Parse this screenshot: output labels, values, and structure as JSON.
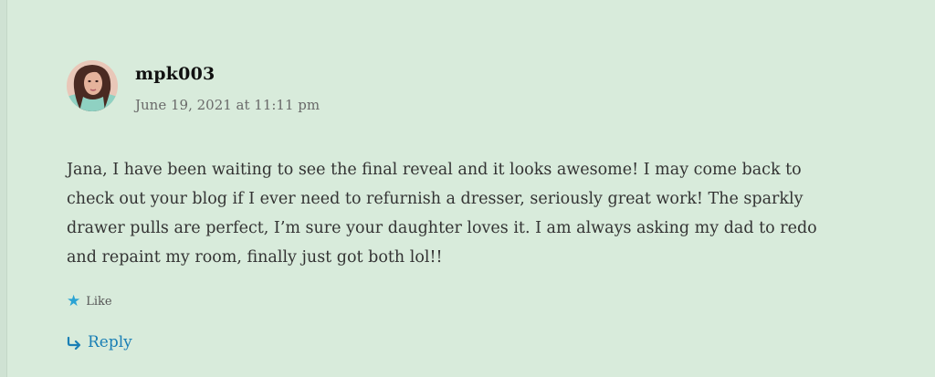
{
  "comment": {
    "author": "mpk003",
    "date": "June 19, 2021 at 11:11 pm",
    "text": "Jana, I have been waiting to see the final reveal and it looks awesome! I may come back to\ncheck out your blog if I ever need to refurnish a dresser, seriously great work! The sparkly\ndrawer pulls are perfect, I’m sure your daughter loves it. I am always asking my dad to redo\nand repaint my room, finally just got both lol!!",
    "like_label": "Like",
    "reply_label": "Reply"
  },
  "icons": {
    "like": "star-icon",
    "reply": "reply-arrow-icon"
  },
  "colors": {
    "background": "#d8ebdb",
    "accent": "#1a7fb5",
    "like_star": "#2aa3d4"
  }
}
